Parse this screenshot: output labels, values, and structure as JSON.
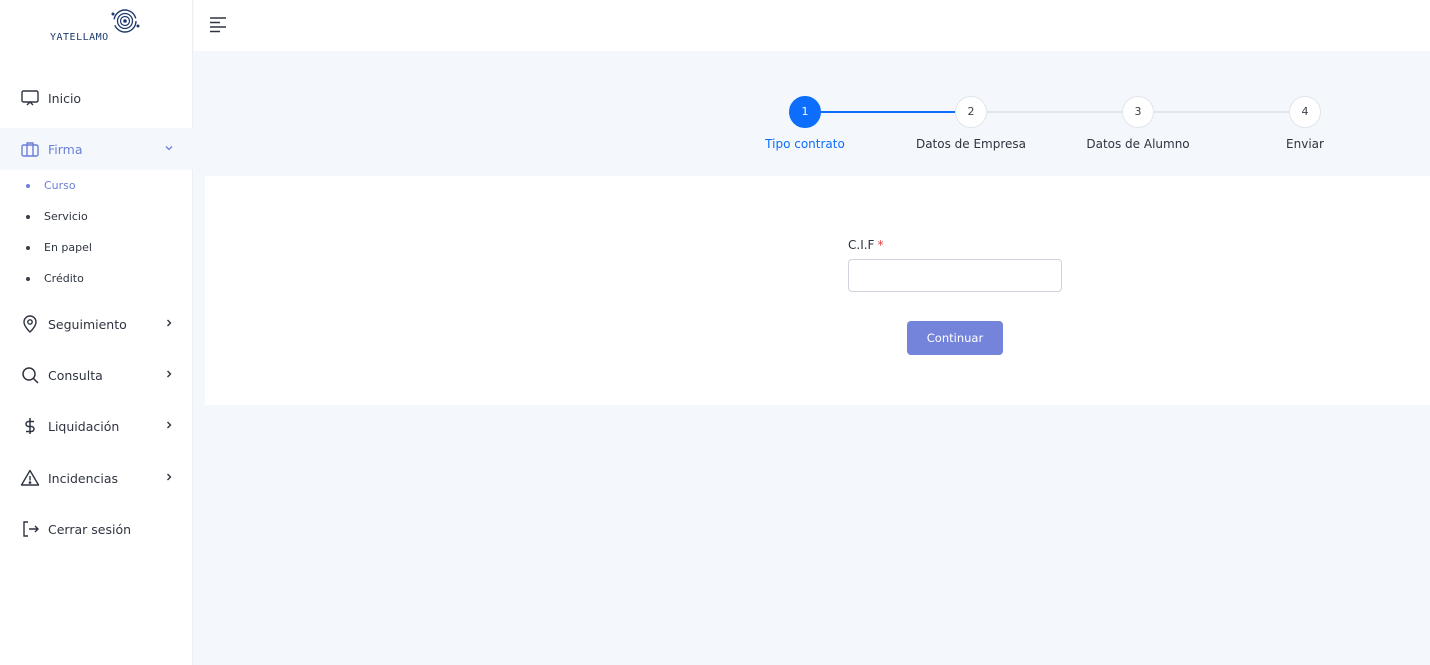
{
  "brand": {
    "logo_text": "YATELLAMO",
    "accent": "#0d6efd",
    "menu_accent": "#6b7fd9"
  },
  "sidebar": {
    "items": [
      {
        "label": "Inicio",
        "icon": "monitor-icon"
      },
      {
        "label": "Firma",
        "icon": "briefcase-icon",
        "expanded": true,
        "children": [
          {
            "label": "Curso",
            "active": true
          },
          {
            "label": "Servicio"
          },
          {
            "label": "En papel"
          },
          {
            "label": "Crédito"
          }
        ]
      },
      {
        "label": "Seguimiento",
        "icon": "location-pin-icon"
      },
      {
        "label": "Consulta",
        "icon": "search-icon"
      },
      {
        "label": "Liquidación",
        "icon": "dollar-icon"
      },
      {
        "label": "Incidencias",
        "icon": "warning-icon"
      },
      {
        "label": "Cerrar sesión",
        "icon": "logout-icon"
      }
    ]
  },
  "stepper": {
    "current": 1,
    "steps": [
      {
        "number": "1",
        "label": "Tipo contrato"
      },
      {
        "number": "2",
        "label": "Datos de Empresa"
      },
      {
        "number": "3",
        "label": "Datos de Alumno"
      },
      {
        "number": "4",
        "label": "Enviar"
      }
    ]
  },
  "form": {
    "cif_label": "C.I.F",
    "required_mark": "*",
    "cif_value": "",
    "continue_label": "Continuar"
  }
}
